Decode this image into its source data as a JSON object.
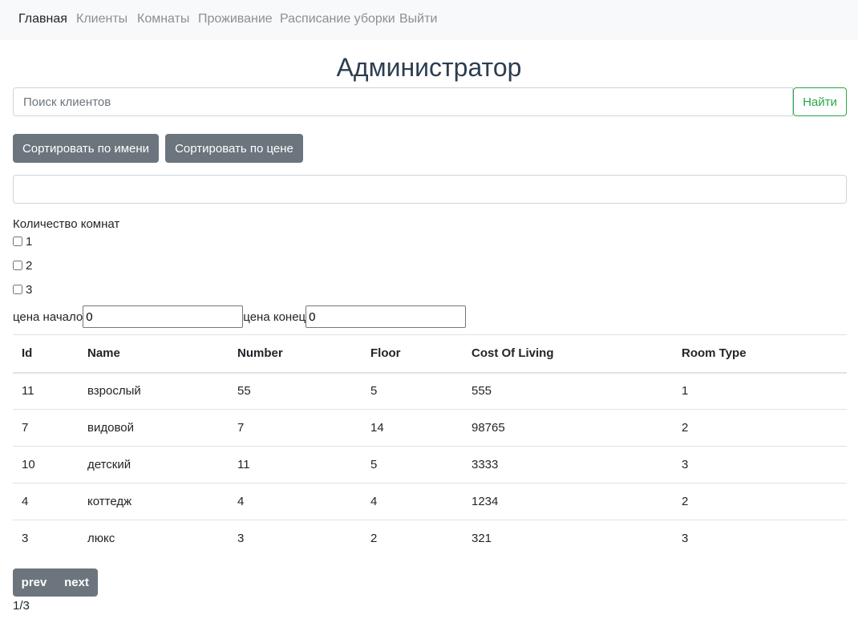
{
  "nav": {
    "items": [
      {
        "label": "Главная",
        "active": true
      },
      {
        "label": "Клиенты",
        "active": false
      },
      {
        "label": "Комнаты",
        "active": false
      },
      {
        "label": "Проживание",
        "active": false
      },
      {
        "label": "Расписание уборки",
        "active": false
      },
      {
        "label": "Выйти",
        "active": false
      }
    ]
  },
  "page": {
    "title": "Администратор"
  },
  "search": {
    "placeholder": "Поиск клиентов",
    "value": "",
    "button_label": "Найти"
  },
  "sort": {
    "by_name_label": "Сортировать по имени",
    "by_price_label": "Сортировать по цене"
  },
  "filter": {
    "text_value": "",
    "room_count_label": "Количество комнат",
    "room_count_options": [
      {
        "label": "1",
        "checked": false
      },
      {
        "label": "2",
        "checked": false
      },
      {
        "label": "3",
        "checked": false
      }
    ],
    "price_start_label": "цена начало",
    "price_start_value": "0",
    "price_end_label": "цена конец",
    "price_end_value": "0"
  },
  "table": {
    "columns": [
      "Id",
      "Name",
      "Number",
      "Floor",
      "Cost Of Living",
      "Room Type"
    ],
    "rows": [
      [
        "11",
        "взрослый",
        "55",
        "5",
        "555",
        "1"
      ],
      [
        "7",
        "видовой",
        "7",
        "14",
        "98765",
        "2"
      ],
      [
        "10",
        "детский",
        "11",
        "5",
        "3333",
        "3"
      ],
      [
        "4",
        "коттедж",
        "4",
        "4",
        "1234",
        "2"
      ],
      [
        "3",
        "люкс",
        "3",
        "2",
        "321",
        "3"
      ]
    ]
  },
  "pagination": {
    "prev_label": "prev",
    "next_label": "next",
    "page_indicator": "1/3"
  },
  "colors": {
    "navbar_bg": "#f8f9fa",
    "nav_active": "#212529",
    "nav_inactive": "#8c8f93",
    "success": "#28a745",
    "secondary": "#6c757d",
    "border": "#dee2e6"
  }
}
